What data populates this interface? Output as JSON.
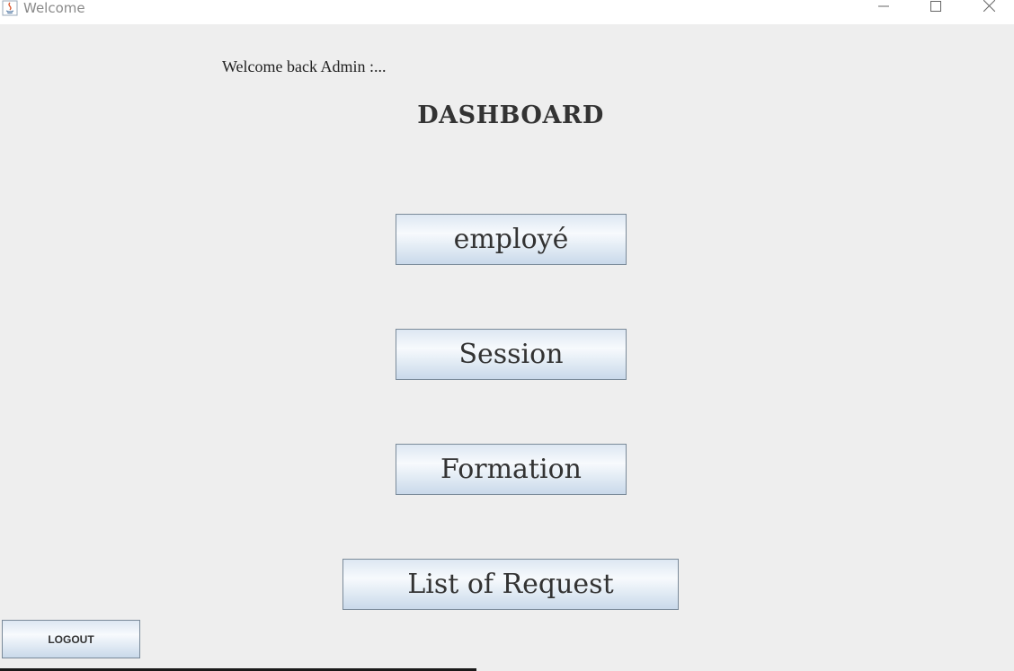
{
  "window": {
    "title": "Welcome",
    "app_icon": "java-icon",
    "controls": {
      "minimize_icon": "minimize-icon",
      "maximize_icon": "maximize-icon",
      "close_icon": "close-icon"
    }
  },
  "main": {
    "welcome_text": "Welcome back Admin :...",
    "dashboard_title": "DASHBOARD",
    "buttons": {
      "employe": "employé",
      "session": "Session",
      "formation": "Formation",
      "requests": "List of Request"
    }
  },
  "footer": {
    "logout_label": "LOGOUT"
  }
}
